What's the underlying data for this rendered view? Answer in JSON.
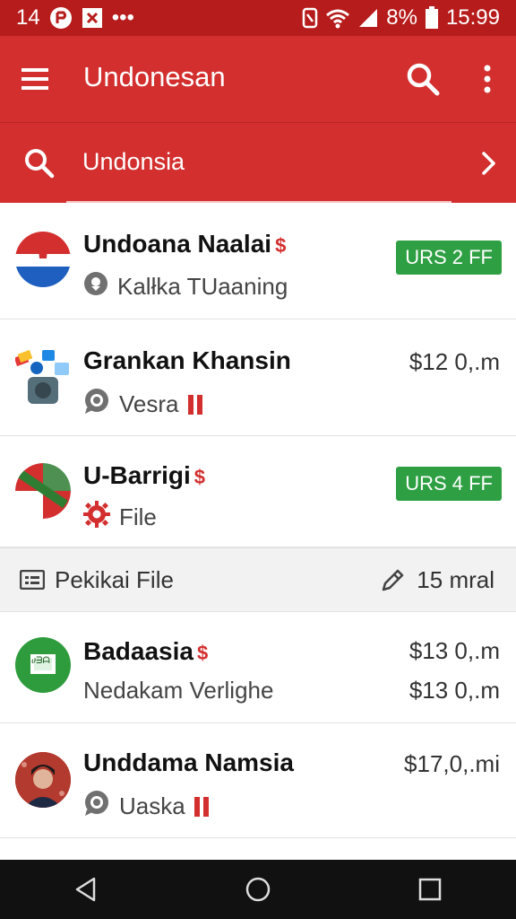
{
  "status_bar": {
    "time_left": "14",
    "battery": "8%",
    "clock": "15:99",
    "more": "•••"
  },
  "app_bar": {
    "title": "Undonesan"
  },
  "search": {
    "query": "Undonsia"
  },
  "items": [
    {
      "title": "Undoana Naalai",
      "subtitle": "Kalłka TUaaning",
      "badge": "URS 2 FF",
      "dollar": "$"
    },
    {
      "title": "Grankan Khansin",
      "subtitle": "Vesra",
      "price": "$12 0,.m"
    },
    {
      "title": "U-Barrigi",
      "subtitle": "File",
      "badge": "URS 4 FF",
      "dollar": "$"
    }
  ],
  "section": {
    "label": "Pekikai File",
    "meta": "15 mral"
  },
  "items2": [
    {
      "title": "Badaasia",
      "subtitle": "Nedakam Verlighe",
      "price": "$13 0,.m",
      "price2": "$13 0,.m",
      "dollar": "$",
      "avatar_text": "ሀᗲᗩ"
    },
    {
      "title": "Unddama Namsia",
      "subtitle": "Uaska",
      "price": "$17,0,.mi"
    }
  ],
  "colors": {
    "primary": "#d32f2f",
    "primary_dark": "#b71c1c",
    "badge_green": "#2ea043"
  }
}
